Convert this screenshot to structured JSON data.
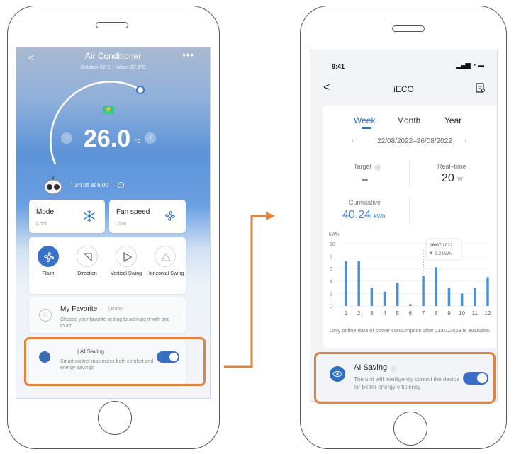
{
  "left": {
    "header": {
      "title": "Air Conditioner",
      "subtitle": "Outdoor 32°C / Indoor 27.5°C",
      "back": "<",
      "more": "•••"
    },
    "thermostat": {
      "temperature": "26.0",
      "unit": "°C",
      "minus": "−",
      "plus": "+",
      "badge": "⚡"
    },
    "timer": {
      "label": "Turn off at 6:00"
    },
    "mode": {
      "title": "Mode",
      "value": "Cool",
      "icon": "snowflake-icon"
    },
    "fan": {
      "title": "Fan speed",
      "value": "75%",
      "icon": "fan-icon"
    },
    "swing": {
      "items": [
        {
          "label": "Flash",
          "icon": "flash-icon",
          "active": true
        },
        {
          "label": "Direction",
          "icon": "direction-icon",
          "active": false
        },
        {
          "label": "Vertical Swing",
          "icon": "vertical-swing-icon",
          "active": false
        },
        {
          "label": "Horizontal Swing",
          "icon": "horizontal-swing-icon",
          "active": false
        }
      ]
    },
    "favorite": {
      "title": "My Favorite",
      "tag": "| Baby",
      "desc": "Choose your favorite setting to activate it with one touch"
    },
    "ai_saving": {
      "title": "| AI Saving",
      "desc": "Smart control maximizes both comfort and energy savings",
      "enabled": true
    }
  },
  "right": {
    "status": {
      "time": "9:41",
      "icons": "▂▄▆ ◔ ▬"
    },
    "header": {
      "back": "<",
      "title": "iECO"
    },
    "tabs": [
      {
        "label": "Week",
        "active": true
      },
      {
        "label": "Month",
        "active": false
      },
      {
        "label": "Year",
        "active": false
      }
    ],
    "date_range": "22/08/2022–26/08/2022",
    "target": {
      "label": "Target",
      "value": "–"
    },
    "realtime": {
      "label": "Real–time",
      "value": "20",
      "unit": "W"
    },
    "cumulative": {
      "label": "Cumulative",
      "value": "40.24",
      "unit": "kWh"
    },
    "note": "Only online data of power consumption after 11/01/2023 is available.",
    "ai_saving": {
      "title": "AI Saving",
      "desc": "The unit will intelligently control the device for better energy efficiency",
      "enabled": true
    }
  },
  "chart_data": {
    "type": "bar",
    "ylabel": "kWh",
    "ylim": [
      0,
      10
    ],
    "yticks": [
      0,
      2,
      4,
      6,
      8,
      10
    ],
    "categories": [
      "1",
      "2",
      "3",
      "4",
      "5",
      "6",
      "7",
      "8",
      "9",
      "10",
      "11",
      "12"
    ],
    "values": [
      7.2,
      7.2,
      2.9,
      2.3,
      3.7,
      0.3,
      4.8,
      6.2,
      2.9,
      2.0,
      2.9,
      4.6
    ],
    "tooltip": {
      "date": "16/07/2022",
      "value": "2.2 kWh",
      "category": "7"
    },
    "colors": {
      "bar": "#4a90d9",
      "accent": "#2e6fbf"
    }
  },
  "colors": {
    "highlight": "#e3823c",
    "accent": "#3a6ec4"
  }
}
